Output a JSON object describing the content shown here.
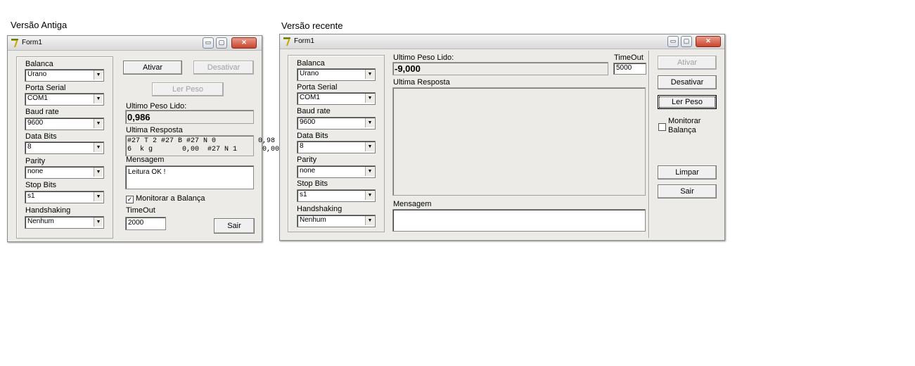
{
  "captions": {
    "old": "Versão Antiga",
    "new": "Versão recente"
  },
  "window_title": "Form1",
  "titlebar_buttons": {
    "minimize": "▭",
    "maximize": "▢",
    "close": "✕"
  },
  "labels": {
    "balanca": "Balanca",
    "porta_serial": "Porta Serial",
    "baud_rate": "Baud rate",
    "data_bits": "Data Bits",
    "parity": "Parity",
    "stop_bits": "Stop Bits",
    "handshaking": "Handshaking",
    "ultimo_peso": "Ultimo Peso Lido:",
    "ultima_resposta": "Ultima Resposta",
    "mensagem": "Mensagem",
    "timeout": "TimeOut"
  },
  "buttons": {
    "ativar": "Ativar",
    "desativar": "Desativar",
    "ler_peso": "Ler Peso",
    "sair": "Sair",
    "limpar": "Limpar"
  },
  "old": {
    "balanca": "Urano",
    "porta_serial": "COM1",
    "baud_rate": "9600",
    "data_bits": "8",
    "parity": "none",
    "stop_bits": "s1",
    "handshaking": "Nenhum",
    "ultimo_peso": "0,986",
    "resposta_linha1": "#27 T 2 #27 B #27 N 0          0,98",
    "resposta_linha2": "6  k g       0,00  #27 N 1      0,00",
    "mensagem": "Leitura OK !",
    "monitorar_label": "Monitorar a Balança",
    "monitorar_checked": true,
    "timeout": "2000"
  },
  "new": {
    "balanca": "Urano",
    "porta_serial": "COM1",
    "baud_rate": "9600",
    "data_bits": "8",
    "parity": "none",
    "stop_bits": "s1",
    "handshaking": "Nenhum",
    "ultimo_peso": "-9,000",
    "timeout": "5000",
    "monitorar_label_1": "Monitorar",
    "monitorar_label_2": "Balança",
    "monitorar_checked": false,
    "mensagem": ""
  }
}
